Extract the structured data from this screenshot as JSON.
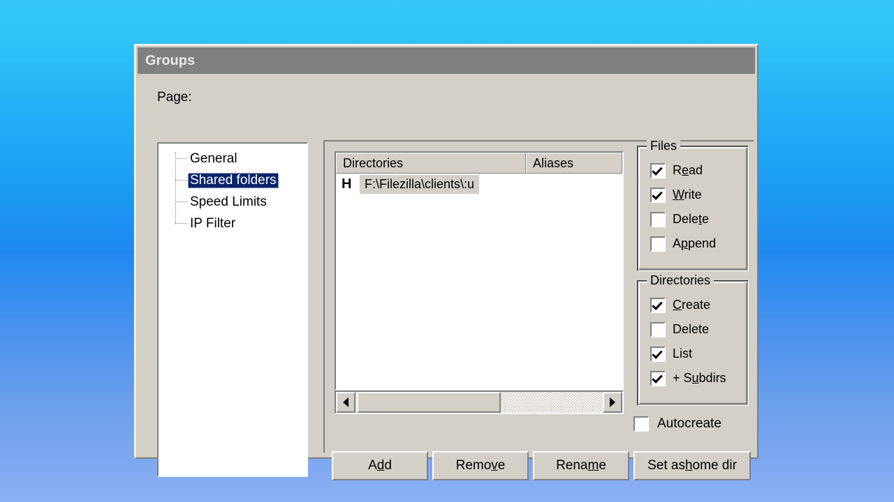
{
  "window": {
    "title": "Groups"
  },
  "sidebar": {
    "label": "Page:",
    "items": [
      {
        "label": "General",
        "selected": false
      },
      {
        "label": "Shared folders",
        "selected": true
      },
      {
        "label": "Speed Limits",
        "selected": false
      },
      {
        "label": "IP Filter",
        "selected": false
      }
    ]
  },
  "listview": {
    "columns": [
      {
        "label": "Directories"
      },
      {
        "label": "Aliases"
      }
    ],
    "rows": [
      {
        "flag": "H",
        "directory": "F:\\Filezilla\\clients\\:u",
        "alias": ""
      }
    ]
  },
  "scrollbar": {
    "left_arrow": "left-arrow-icon",
    "right_arrow": "right-arrow-icon"
  },
  "files_group": {
    "title": "Files",
    "items": [
      {
        "label": "Read",
        "accel": "e",
        "checked": true
      },
      {
        "label": "Write",
        "accel": "W",
        "checked": true
      },
      {
        "label": "Delete",
        "accel": "t",
        "checked": false
      },
      {
        "label": "Append",
        "accel": "p",
        "checked": false
      }
    ]
  },
  "directories_group": {
    "title": "Directories",
    "items": [
      {
        "label": "Create",
        "accel": "C",
        "checked": true
      },
      {
        "label": "Delete",
        "accel": "",
        "checked": false
      },
      {
        "label": "List",
        "accel": "",
        "checked": true
      },
      {
        "label": "+ Subdirs",
        "accel": "u",
        "checked": true
      }
    ]
  },
  "autocreate": {
    "label": "Autocreate",
    "checked": false
  },
  "buttons": [
    {
      "label": "Add",
      "accel": "d"
    },
    {
      "label": "Remove",
      "accel": "v"
    },
    {
      "label": "Rename",
      "accel": "m"
    },
    {
      "label": "Set as home dir",
      "accel": "h"
    }
  ],
  "colors": {
    "face": "#d4d0c8",
    "titlebar": "#808080",
    "selection": "#0a246a",
    "desktop_top": "#35c8f8",
    "desktop_bottom": "#8bb0f3"
  }
}
